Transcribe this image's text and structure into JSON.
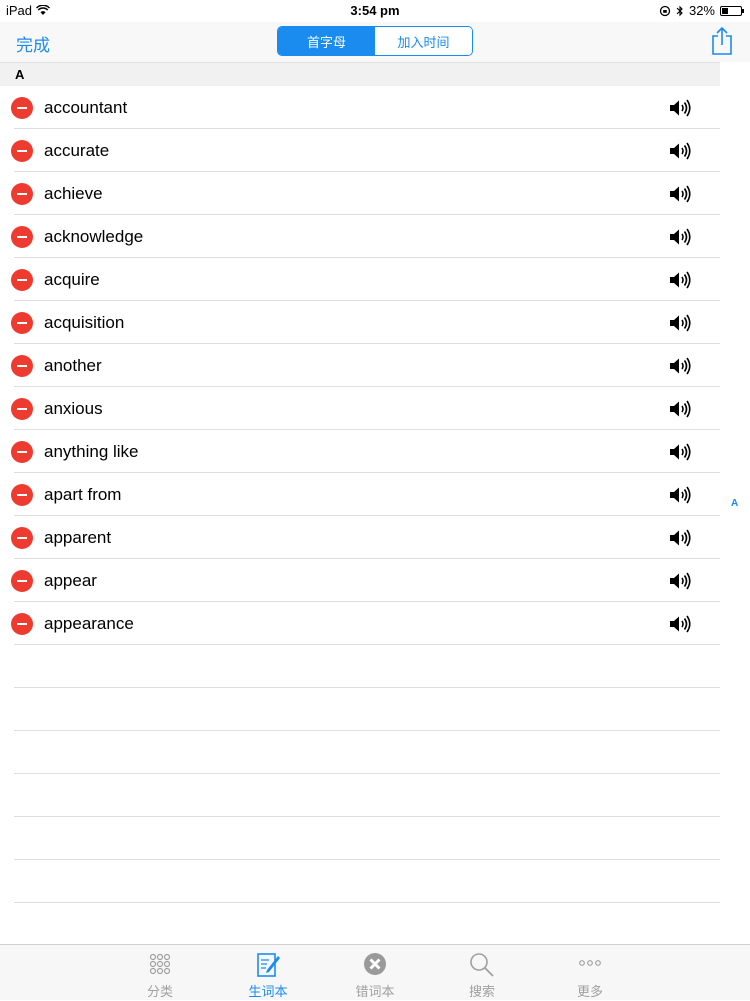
{
  "status_bar": {
    "device": "iPad",
    "time": "3:54 pm",
    "battery": "32%",
    "battery_level_percent": 32
  },
  "nav": {
    "done_label": "完成",
    "segments": [
      {
        "label": "首字母",
        "active": true
      },
      {
        "label": "加入时间",
        "active": false
      }
    ]
  },
  "section": {
    "header": "A"
  },
  "words": [
    "accountant",
    "accurate",
    "achieve",
    "acknowledge",
    "acquire",
    "acquisition",
    "another",
    "anxious",
    "anything like",
    "apart from",
    "apparent",
    "appear",
    "appearance"
  ],
  "index": {
    "letters": [
      "A"
    ]
  },
  "tabs": [
    {
      "label": "分类",
      "icon": "grid-dots-icon",
      "active": false
    },
    {
      "label": "生词本",
      "icon": "notebook-pen-icon",
      "active": true
    },
    {
      "label": "错词本",
      "icon": "x-circle-icon",
      "active": false
    },
    {
      "label": "搜索",
      "icon": "magnifier-icon",
      "active": false
    },
    {
      "label": "更多",
      "icon": "more-dots-icon",
      "active": false
    }
  ],
  "colors": {
    "accent": "#1a8cf0",
    "delete": "#ee3b2f",
    "tab_inactive": "#a0a0a0"
  }
}
